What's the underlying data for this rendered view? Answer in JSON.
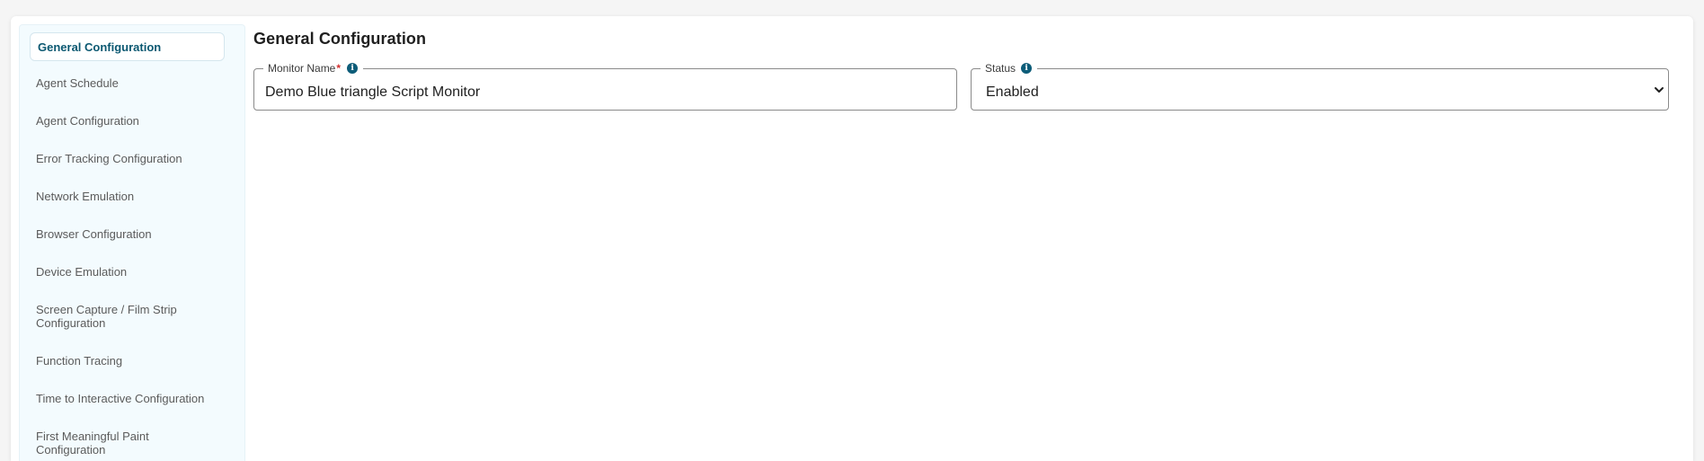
{
  "sidebar": {
    "items": [
      {
        "label": "General Configuration",
        "active": true
      },
      {
        "label": "Agent Schedule"
      },
      {
        "label": "Agent Configuration"
      },
      {
        "label": "Error Tracking Configuration"
      },
      {
        "label": "Network Emulation"
      },
      {
        "label": "Browser Configuration"
      },
      {
        "label": "Device Emulation"
      },
      {
        "label": "Screen Capture / Film Strip Configuration"
      },
      {
        "label": "Function Tracing"
      },
      {
        "label": "Time to Interactive Configuration"
      },
      {
        "label": "First Meaningful Paint Configuration"
      }
    ]
  },
  "main": {
    "title": "General Configuration",
    "monitor_name": {
      "label": "Monitor Name",
      "required_mark": "*",
      "value": "Demo Blue triangle Script Monitor"
    },
    "status": {
      "label": "Status",
      "value": "Enabled"
    }
  },
  "icons": {
    "info": "i"
  },
  "colors": {
    "accent": "#0b5871",
    "sidebar_bg": "#f3fbfe",
    "required": "#d32f2f"
  }
}
